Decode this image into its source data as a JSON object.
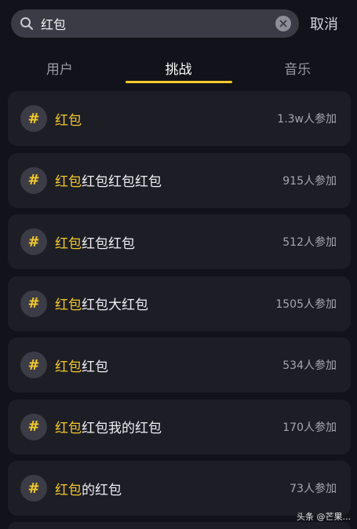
{
  "search": {
    "value": "红包",
    "cancel_label": "取消"
  },
  "tabs": [
    {
      "label": "用户",
      "active": false
    },
    {
      "label": "挑战",
      "active": true
    },
    {
      "label": "音乐",
      "active": false
    }
  ],
  "highlight_color": "#f5c92b",
  "results": [
    {
      "icon": "#",
      "highlight": "红包",
      "rest": "",
      "count": "1.3w人参加"
    },
    {
      "icon": "#",
      "highlight": "红包",
      "rest": "红包红包红包",
      "count": "915人参加"
    },
    {
      "icon": "#",
      "highlight": "红包",
      "rest": "红包红包",
      "count": "512人参加"
    },
    {
      "icon": "#",
      "highlight": "红包",
      "rest": "红包大红包",
      "count": "1505人参加"
    },
    {
      "icon": "#",
      "highlight": "红包",
      "rest": "红包",
      "count": "534人参加"
    },
    {
      "icon": "#",
      "highlight": "红包",
      "rest": "红包我的红包",
      "count": "170人参加"
    },
    {
      "icon": "#",
      "highlight": "红包",
      "rest": "的红包",
      "count": "73人参加"
    }
  ],
  "watermark": "头条 @芒果..."
}
